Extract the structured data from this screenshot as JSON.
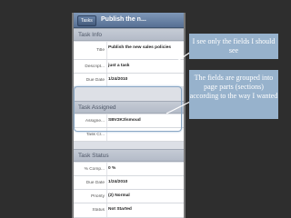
{
  "app": {
    "back_label": "Tasks",
    "title": "Publish the n..."
  },
  "sections": [
    {
      "header": "Task Info",
      "fields": [
        {
          "label": "Title",
          "value": "Publish the new sales policies"
        },
        {
          "label": "Descript...",
          "value": "just a task"
        },
        {
          "label": "Due Date",
          "value": "1/24/2010"
        }
      ]
    },
    {
      "header": "Task Assigned",
      "fields": [
        {
          "label": "Assigne...",
          "value": "SBV2K3\\smoud"
        },
        {
          "label": "Task Cr...",
          "value": ""
        }
      ]
    },
    {
      "header": "Task Status",
      "fields": [
        {
          "label": "% Comp...",
          "value": "0 %"
        },
        {
          "label": "Due Date",
          "value": "1/24/2010"
        },
        {
          "label": "Priority",
          "value": "(2) Normal"
        },
        {
          "label": "Status",
          "value": "Not Started"
        }
      ]
    }
  ],
  "callouts": [
    "I see only the fields I should see",
    "The fields are grouped into page parts (sections) according to the way I wanted"
  ],
  "colors": {
    "background": "#2e2e2e",
    "callout": "#97b2cc",
    "topbar": "#566f93"
  }
}
